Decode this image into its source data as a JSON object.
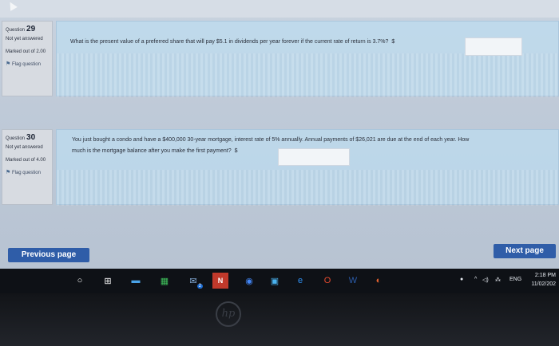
{
  "questions": [
    {
      "label": "Question",
      "number": "29",
      "state": "Not yet answered",
      "marked": "Marked out of 2.00",
      "flag": "Flag question",
      "text": "What is the present value of a preferred share that will pay $5.1 in dividends per year forever if the current rate of return is 3.7%?",
      "currency": "$"
    },
    {
      "label": "Question",
      "number": "30",
      "state": "Not yet answered",
      "marked": "Marked out of 4.00",
      "flag": "Flag question",
      "text_line1": "You just bought a condo and have a $400,000 30-year mortgage, interest rate of 5% annually. Annual payments of $26,021 are due at the end of each year. How",
      "text_line2": "much is the mortgage balance after you make the first payment?",
      "currency": "$"
    }
  ],
  "nav": {
    "previous": "Previous page",
    "next": "Next page"
  },
  "taskbar": {
    "badge": "2",
    "lang": "ENG",
    "time": "2:18 PM",
    "date": "11/02/202"
  },
  "brand": "hp"
}
